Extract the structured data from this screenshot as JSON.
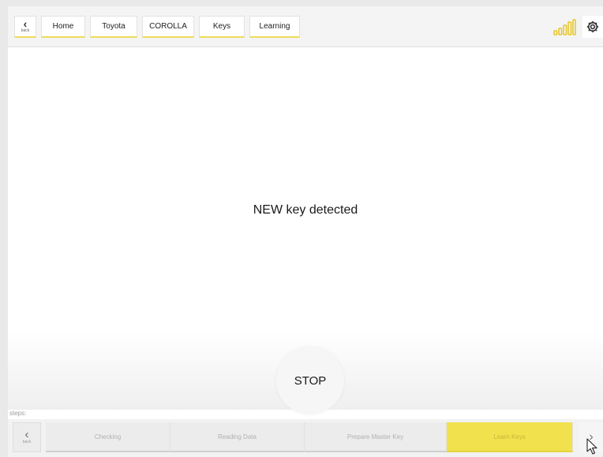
{
  "header": {
    "back_label": "back",
    "breadcrumbs": [
      "Home",
      "Toyota",
      "COROLLA",
      "Keys",
      "Learning"
    ]
  },
  "main": {
    "message": "NEW key detected",
    "stop_label": "STOP"
  },
  "steps": {
    "label": "steps:",
    "back_label": "back",
    "items": [
      "Checking",
      "Reading Data",
      "Prepare Master Key",
      "Learn Keys"
    ],
    "active_index": 3
  },
  "icons": {
    "signal": "signal-strength-icon",
    "settings": "gear-icon",
    "back": "chevron-left-icon",
    "next": "chevron-right-icon",
    "cursor": "mouse-pointer-icon"
  },
  "colors": {
    "accent": "#f1e24d",
    "signal": "#e7c72a"
  }
}
